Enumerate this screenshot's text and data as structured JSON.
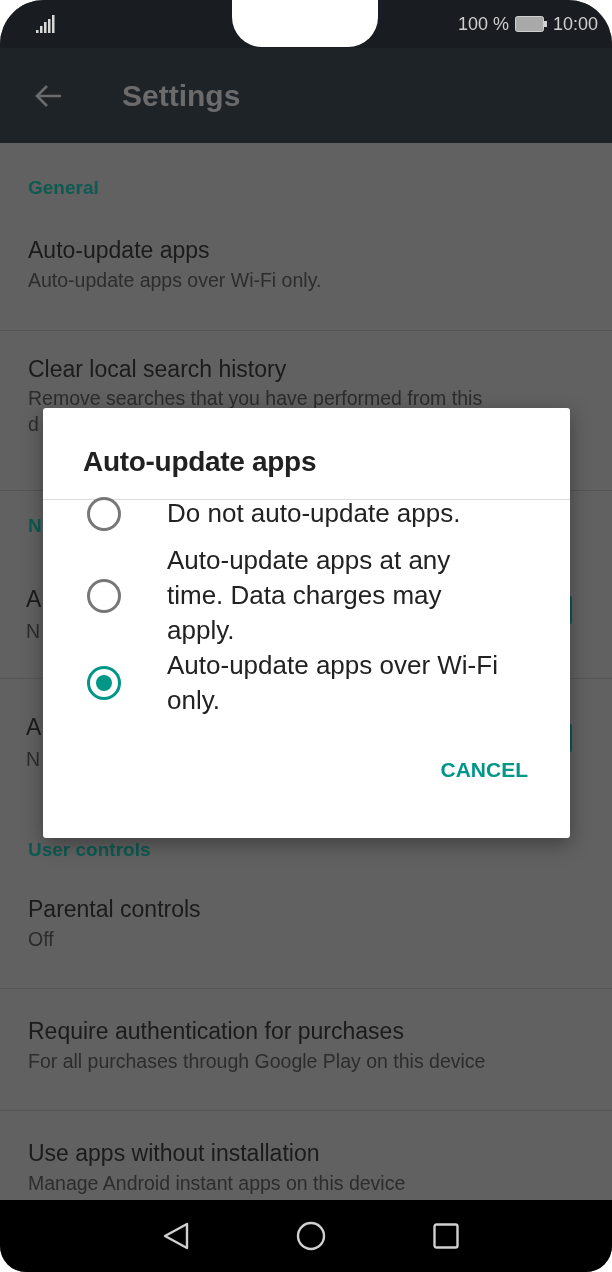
{
  "status_bar": {
    "battery": "100 %",
    "time": "10:00"
  },
  "app_bar": {
    "title": "Settings"
  },
  "sections": [
    {
      "header": "General",
      "items": [
        {
          "title": "Auto-update apps",
          "subtitle": "Auto-update apps over Wi-Fi only."
        },
        {
          "title": "Clear local search history",
          "subtitle": "Remove searches that you have performed from this",
          "subtitle_more": "d"
        }
      ]
    },
    {
      "header": "N",
      "items": [
        {
          "title": "A",
          "subtitle": "N"
        },
        {
          "title": "A",
          "subtitle": "N"
        }
      ]
    },
    {
      "header": "User controls",
      "items": [
        {
          "title": "Parental controls",
          "subtitle": "Off"
        },
        {
          "title": "Require authentication for purchases",
          "subtitle": "For all purchases through Google Play on this device"
        },
        {
          "title": "Use apps without installation",
          "subtitle": "Manage Android instant apps on this device"
        }
      ]
    }
  ],
  "dialog": {
    "title": "Auto-update apps",
    "options": [
      {
        "label": "Do not auto-update apps.",
        "selected": false
      },
      {
        "label": "Auto-update apps at any time. Data charges may apply.",
        "selected": false
      },
      {
        "label": "Auto-update apps over Wi-Fi only.",
        "selected": true
      }
    ],
    "button": "CANCEL"
  }
}
